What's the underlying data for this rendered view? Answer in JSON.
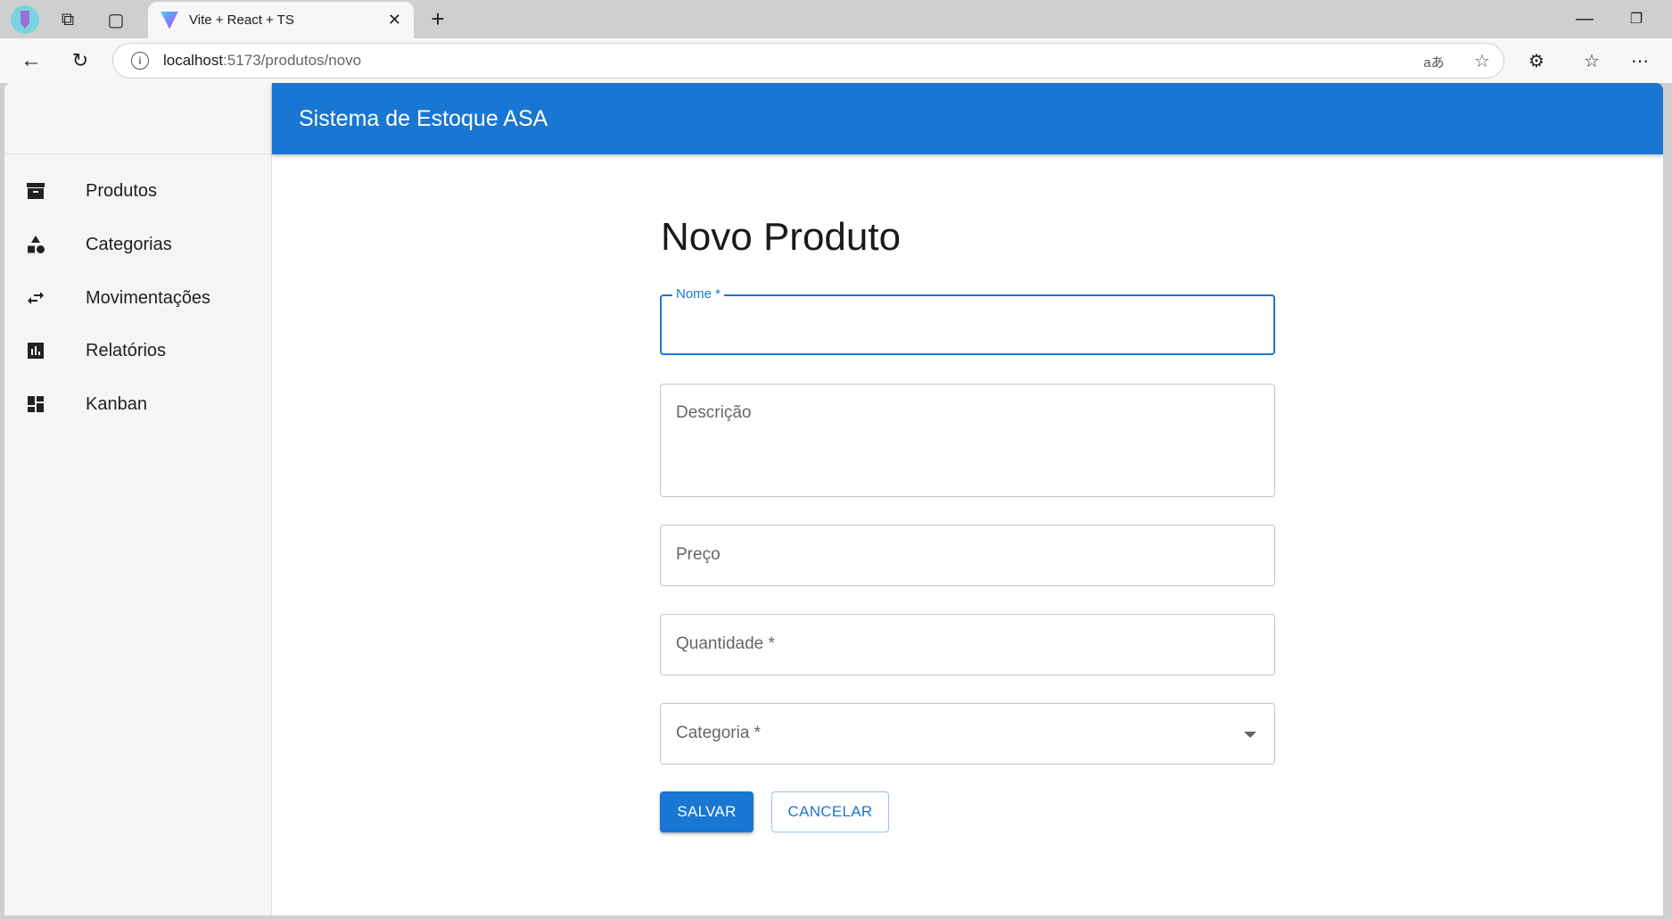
{
  "browser": {
    "tab_title": "Vite + React + TS",
    "url_host": "localhost",
    "url_path": ":5173/produtos/novo"
  },
  "app": {
    "title": "Sistema de Estoque ASA",
    "sidebar": {
      "items": [
        {
          "label": "Produtos",
          "icon": "archive-icon"
        },
        {
          "label": "Categorias",
          "icon": "category-icon"
        },
        {
          "label": "Movimentações",
          "icon": "swap-icon"
        },
        {
          "label": "Relatórios",
          "icon": "bar-chart-icon"
        },
        {
          "label": "Kanban",
          "icon": "dashboard-icon"
        }
      ]
    }
  },
  "form": {
    "title": "Novo Produto",
    "fields": {
      "nome": {
        "label": "Nome *",
        "value": ""
      },
      "descricao": {
        "label": "Descrição",
        "value": ""
      },
      "preco": {
        "label": "Preço",
        "value": ""
      },
      "quantidade": {
        "label": "Quantidade *",
        "value": ""
      },
      "categoria": {
        "label": "Categoria *",
        "value": ""
      }
    },
    "save_label": "SALVAR",
    "cancel_label": "CANCELAR"
  },
  "colors": {
    "primary": "#1976d2"
  }
}
